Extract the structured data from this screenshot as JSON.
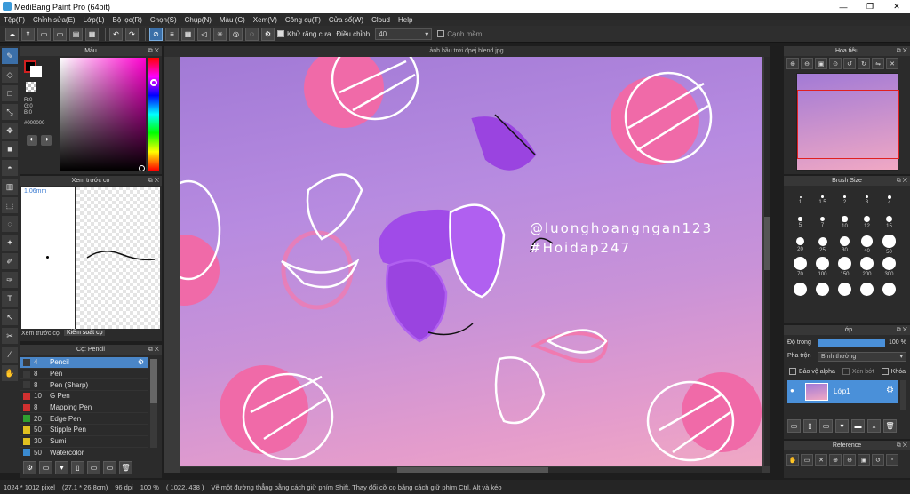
{
  "window": {
    "title": "MediBang Paint Pro (64bit)",
    "controls": [
      "—",
      "❐",
      "✕"
    ]
  },
  "menu": [
    "Tệp(F)",
    "Chỉnh sửa(E)",
    "Lớp(L)",
    "Bộ lọc(R)",
    "Chọn(S)",
    "Chụp(N)",
    "Màu (C)",
    "Xem(V)",
    "Công cụ(T)",
    "Cửa sổ(W)",
    "Cloud",
    "Help"
  ],
  "toolbar": {
    "antialias_label": "Khử răng cưa",
    "adjust_label": "Điều chỉnh",
    "adjust_value": "40",
    "edge_label": "Cạnh mềm"
  },
  "color_panel": {
    "title": "Màu",
    "r": "R:0",
    "g": "G:0",
    "b": "B:0",
    "hex": "#000000"
  },
  "preview_panel": {
    "title": "Xem trước cọ",
    "size": "1.06mm",
    "tab1": "Xem trước cọ",
    "tab2": "Kiểm soát cọ"
  },
  "brush_panel": {
    "title": "Cọ: Pencil",
    "brushes": [
      {
        "size": "4",
        "name": "Pencil",
        "color": "#3a3a3a",
        "selected": true
      },
      {
        "size": "8",
        "name": "Pen",
        "color": "#3a3a3a"
      },
      {
        "size": "8",
        "name": "Pen (Sharp)",
        "color": "#3a3a3a"
      },
      {
        "size": "10",
        "name": "G Pen",
        "color": "#d03030"
      },
      {
        "size": "8",
        "name": "Mapping Pen",
        "color": "#d03030"
      },
      {
        "size": "20",
        "name": "Edge Pen",
        "color": "#30a030"
      },
      {
        "size": "50",
        "name": "Stipple Pen",
        "color": "#e0c020"
      },
      {
        "size": "30",
        "name": "Sumi",
        "color": "#e0c020"
      },
      {
        "size": "50",
        "name": "Watercolor",
        "color": "#3a8ad0"
      }
    ]
  },
  "document": {
    "tab": "ảnh bầu trời đpej blend.jpg",
    "watermark1": "@luonghoangngan123",
    "watermark2": "#Hoidap247"
  },
  "navigator": {
    "title": "Hoa tiêu"
  },
  "brush_size": {
    "title": "Brush Size",
    "sizes": [
      "1",
      "1.5",
      "2",
      "3",
      "4",
      "5",
      "7",
      "10",
      "12",
      "15",
      "20",
      "25",
      "30",
      "40",
      "50",
      "70",
      "100",
      "150",
      "200",
      "300",
      "",
      "",
      "",
      "",
      ""
    ]
  },
  "layer_panel": {
    "title": "Lớp",
    "opacity_label": "Độ trong",
    "opacity_value": "100 %",
    "opacity_fraction": 1.0,
    "blend_label": "Pha trộn",
    "blend_value": "Bình thường",
    "protect_alpha": "Bảo vệ alpha",
    "clipping": "Xén bớt",
    "lock": "Khóa",
    "layer_name": "Lớp1"
  },
  "reference_panel": {
    "title": "Reference"
  },
  "status": {
    "dims": "1024 * 1012 pixel",
    "size": "(27.1 * 26.8cm)",
    "dpi": "96 dpi",
    "zoom": "100 %",
    "coords": "( 1022, 438 )",
    "hint": "Vẽ một đường thẳng bằng cách giữ phím Shift, Thay đổi cỡ cọ bằng cách giữ phím Ctrl, Alt và kéo"
  },
  "colors": {
    "accent": "#3b6fa8",
    "selected_row": "#4a86c8",
    "layer_selected": "#4a90d9",
    "sky_top": "#a27ad6",
    "sky_bottom": "#f0a8c4",
    "pink": "#f06aa8",
    "purple": "#a04be8"
  }
}
